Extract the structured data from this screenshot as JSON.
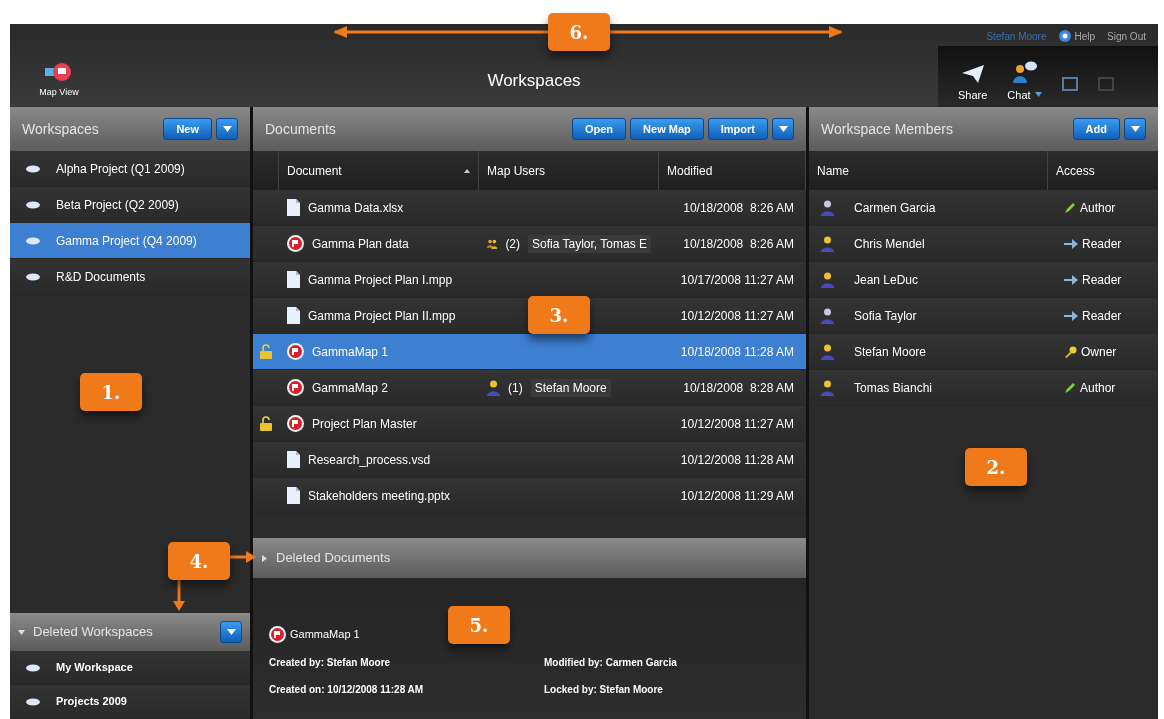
{
  "user_bar": {
    "user": "Stefan Moore",
    "links": [
      {
        "kind": "help",
        "label": "Help"
      },
      {
        "kind": "plain",
        "label": "Sign Out"
      }
    ]
  },
  "toolbar": {
    "map_view": "Map View",
    "title": "Workspaces",
    "share": "Share",
    "chat": "Chat"
  },
  "workspaces": {
    "title": "Workspaces",
    "new_button": "New",
    "items": [
      {
        "name": "Alpha Project (Q1 2009)",
        "selected": false
      },
      {
        "name": "Beta Project (Q2 2009)",
        "selected": false
      },
      {
        "name": "Gamma Project (Q4 2009)",
        "selected": true
      },
      {
        "name": "R&D Documents",
        "selected": false
      }
    ]
  },
  "deleted_workspaces": {
    "title": "Deleted Workspaces",
    "expanded": true,
    "items": [
      "My Workspace",
      "Projects 2009"
    ]
  },
  "documents": {
    "title": "Documents",
    "buttons": [
      "Open",
      "New Map",
      "Import"
    ],
    "columns": [
      {
        "label": "Document",
        "sorted": true
      },
      {
        "label": "Map Users",
        "sorted": false
      },
      {
        "label": "Modified",
        "sorted": false
      }
    ],
    "rows": [
      {
        "kind": "file",
        "name": "Gamma Data.xlsx",
        "locked": false,
        "modified": "10/18/2008  8:26 AM",
        "selected": false
      },
      {
        "kind": "map",
        "name": "Gamma Plan data",
        "locked": false,
        "users": {
          "kind": "group",
          "count": "(2)",
          "names": "Sofia Taylor,  Tomas E"
        },
        "modified": "10/18/2008  8:26 AM",
        "selected": false
      },
      {
        "kind": "file",
        "name": "Gamma Project Plan I.mpp",
        "locked": false,
        "modified": "10/17/2008 11:27 AM",
        "selected": false
      },
      {
        "kind": "file",
        "name": "Gamma Project Plan II.mpp",
        "locked": false,
        "modified": "10/12/2008 11:27 AM",
        "selected": false
      },
      {
        "kind": "map",
        "name": "GammaMap 1",
        "locked": true,
        "modified": "10/18/2008 11:28 AM",
        "selected": true
      },
      {
        "kind": "map",
        "name": "GammaMap 2",
        "locked": false,
        "users": {
          "kind": "person",
          "count": "(1)",
          "names": "Stefan Moore"
        },
        "modified": "10/18/2008  8:28 AM",
        "selected": false
      },
      {
        "kind": "map",
        "name": "Project Plan Master",
        "locked": true,
        "modified": "10/12/2008 11:27 AM",
        "selected": false
      },
      {
        "kind": "file",
        "name": "Research_process.vsd",
        "locked": false,
        "modified": "10/12/2008 11:28 AM",
        "selected": false
      },
      {
        "kind": "file",
        "name": "Stakeholders meeting.pptx",
        "locked": false,
        "modified": "10/12/2008 11:29 AM",
        "selected": false
      }
    ]
  },
  "deleted_documents": {
    "title": "Deleted Documents",
    "expanded": false
  },
  "details": {
    "name": "GammaMap 1",
    "created_by": "Created by: Stefan Moore",
    "modified_by": "Modified by: Carmen Garcia",
    "created_on": "Created on: 10/12/2008 11:28 AM",
    "locked_by": "Locked by: Stefan Moore"
  },
  "members": {
    "title": "Workspace Members",
    "add_button": "Add",
    "columns": [
      "Name",
      "Access"
    ],
    "rows": [
      {
        "name": "Carmen Garcia",
        "access": "Author",
        "kind": "author"
      },
      {
        "name": "Chris Mendel",
        "access": "Reader",
        "kind": "reader"
      },
      {
        "name": "Jean LeDuc",
        "access": "Reader",
        "kind": "reader"
      },
      {
        "name": "Sofia Taylor",
        "access": "Reader",
        "kind": "reader"
      },
      {
        "name": "Stefan Moore",
        "access": "Owner",
        "kind": "owner"
      },
      {
        "name": "Tomas Bianchi",
        "access": "Author",
        "kind": "author"
      }
    ]
  },
  "callouts": [
    "6.",
    "1.",
    "3.",
    "2.",
    "4.",
    "5."
  ]
}
